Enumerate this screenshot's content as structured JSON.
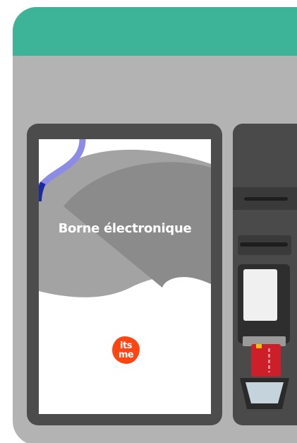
{
  "screen": {
    "title": "Borne électronique"
  },
  "logo": {
    "line1": "its",
    "line2": "me"
  },
  "colors": {
    "header": "#3db497",
    "body": "#b3b3b3",
    "brand": "#ff4612"
  }
}
